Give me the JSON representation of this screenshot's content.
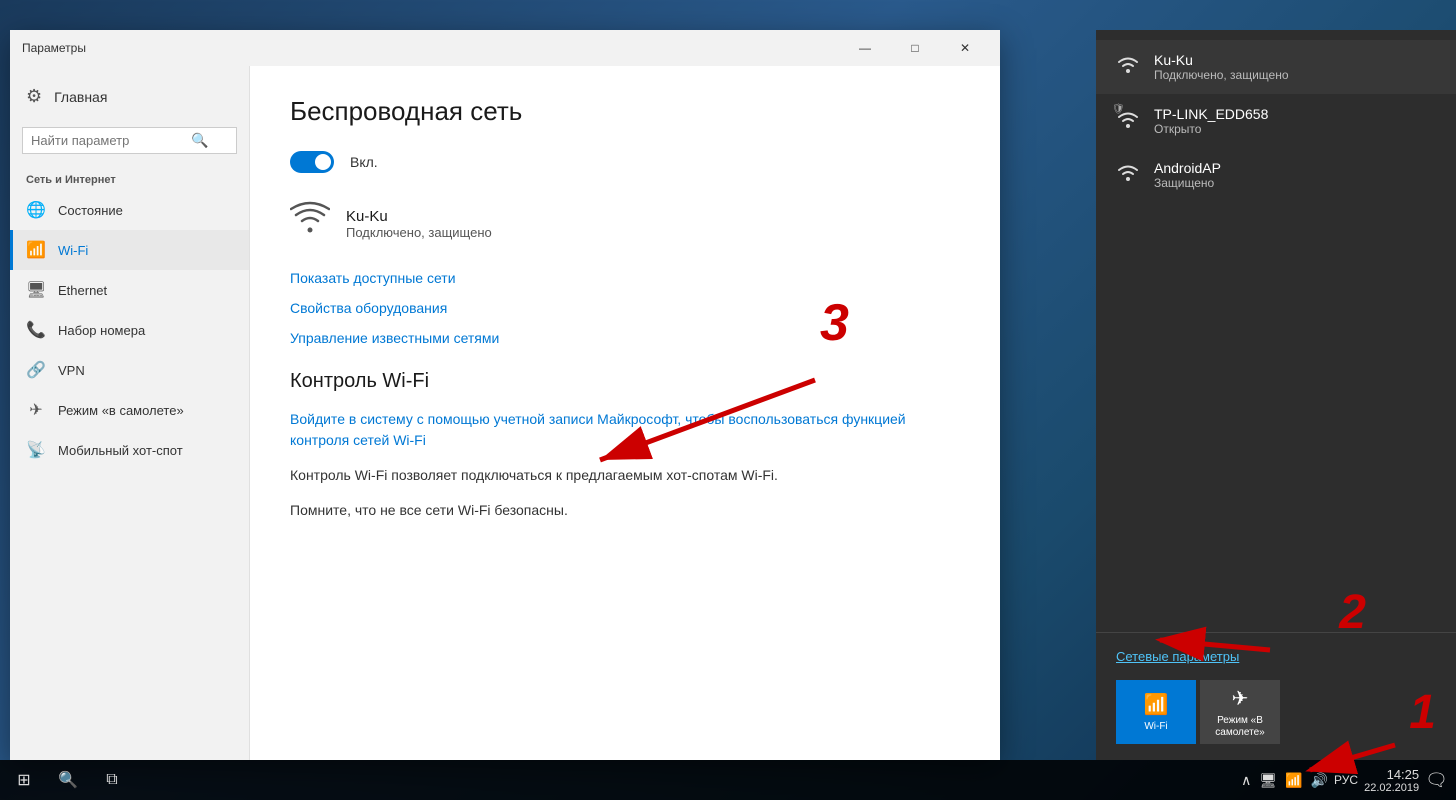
{
  "window": {
    "title": "Параметры",
    "minimize": "—",
    "maximize": "□",
    "close": "✕"
  },
  "sidebar": {
    "home_label": "Главная",
    "search_placeholder": "Найти параметр",
    "section_label": "Сеть и Интернет",
    "nav_items": [
      {
        "id": "status",
        "icon": "🌐",
        "label": "Состояние"
      },
      {
        "id": "wifi",
        "icon": "📶",
        "label": "Wi-Fi",
        "active": true
      },
      {
        "id": "ethernet",
        "icon": "🖥",
        "label": "Ethernet"
      },
      {
        "id": "dialup",
        "icon": "📞",
        "label": "Набор номера"
      },
      {
        "id": "vpn",
        "icon": "🔗",
        "label": "VPN"
      },
      {
        "id": "airplane",
        "icon": "✈",
        "label": "Режим «в самолете»"
      },
      {
        "id": "hotspot",
        "icon": "📡",
        "label": "Мобильный хот-спот"
      }
    ]
  },
  "main": {
    "title": "Беспроводная сеть",
    "toggle_label": "Вкл.",
    "network_name": "Ku-Ku",
    "network_status": "Подключено, защищено",
    "link_show_networks": "Показать доступные сети",
    "link_adapter_props": "Свойства оборудования",
    "link_manage_networks": "Управление известными сетями",
    "section_wifi_control": "Контроль Wi-Fi",
    "ms_login_text": "Войдите в систему с помощью учетной записи Майкрософт, чтобы воспользоваться функцией контроля сетей Wi-Fi",
    "body_text_1": "Контроль Wi-Fi позволяет подключаться к предлагаемым хот-спотам Wi-Fi.",
    "body_text_2": "Помните, что не все сети Wi-Fi безопасны."
  },
  "flyout": {
    "network_settings_label": "Сетевые параметры",
    "networks": [
      {
        "name": "Ku-Ku",
        "status": "Подключено, защищено",
        "connected": true,
        "secured": true
      },
      {
        "name": "TP-LINK_EDD658",
        "status": "Открыто",
        "connected": false,
        "secured": false,
        "shield": true
      },
      {
        "name": "AndroidAP",
        "status": "Защищено",
        "connected": false,
        "secured": true
      }
    ],
    "tiles": [
      {
        "label": "Wi-Fi",
        "active": true,
        "icon": "📶"
      },
      {
        "label": "Режим «В самолете»",
        "active": false,
        "icon": "✈"
      }
    ]
  },
  "taskbar": {
    "lang": "РУС",
    "time": "14:25",
    "date": "22.02.2019"
  },
  "annotations": {
    "num1": "1",
    "num2": "2",
    "num3": "3"
  }
}
